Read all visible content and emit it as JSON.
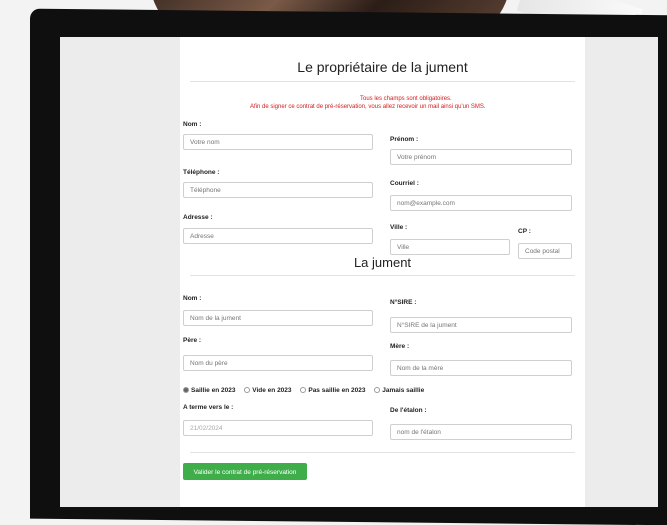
{
  "form": {
    "title": "Le propriétaire de la jument",
    "required_note_line1": "Tous les champs sont obligatoires.",
    "required_note_line2": "Afin de signer ce contrat de pré-réservation, vous allez recevoir un mail ainsi qu'un SMS.",
    "owner": {
      "nom_label": "Nom :",
      "nom_placeholder": "Votre nom",
      "prenom_label": "Prénom :",
      "prenom_placeholder": "Votre prénom",
      "telephone_label": "Téléphone :",
      "telephone_placeholder": "Téléphone",
      "courriel_label": "Courriel :",
      "courriel_placeholder": "nom@example.com",
      "adresse_label": "Adresse :",
      "adresse_placeholder": "Adresse",
      "ville_label": "Ville :",
      "ville_placeholder": "Ville",
      "cp_label": "CP :",
      "cp_placeholder": "Code postal"
    },
    "mare_title": "La jument",
    "mare": {
      "nom_label": "Nom :",
      "nom_placeholder": "Nom de la jument",
      "sire_label": "N°SIRE :",
      "sire_placeholder": "N°SIRE de la jument",
      "pere_label": "Père :",
      "pere_placeholder": "Nom du père",
      "mere_label": "Mère :",
      "mere_placeholder": "Nom de la mère",
      "status_options": [
        "Saillie en 2023",
        "Vide en 2023",
        "Pas saillie en 2023",
        "Jamais saillie"
      ],
      "status_selected": "Saillie en 2023",
      "terme_label": "A terme vers le :",
      "terme_value": "21/02/2024",
      "etalon_label": "De l'étalon :",
      "etalon_placeholder": "nom de l'étalon"
    },
    "submit_label": "Valider le contrat de pré-réservation"
  }
}
